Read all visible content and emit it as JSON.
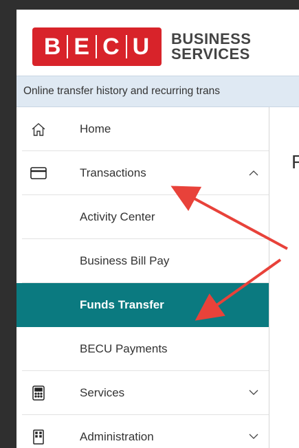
{
  "header": {
    "logo_letters": "B|E|C|U",
    "logo_line1": "BUSINESS",
    "logo_line2": "SERVICES"
  },
  "banner": {
    "text": "Online transfer history and recurring trans"
  },
  "sidebar": {
    "items": [
      {
        "label": "Home",
        "icon": "home-icon"
      },
      {
        "label": "Transactions",
        "icon": "card-icon",
        "expanded": true
      },
      {
        "label": "Activity Center"
      },
      {
        "label": "Business Bill Pay"
      },
      {
        "label": "Funds Transfer",
        "active": true
      },
      {
        "label": "BECU Payments"
      },
      {
        "label": "Services",
        "icon": "calculator-icon"
      },
      {
        "label": "Administration",
        "icon": "building-icon"
      }
    ]
  },
  "main": {
    "title_fragment": "F"
  },
  "colors": {
    "brand_red": "#d8232a",
    "active_teal": "#0b7a80",
    "banner_bg": "#dfe9f3",
    "arrow_red": "#e8423a"
  }
}
